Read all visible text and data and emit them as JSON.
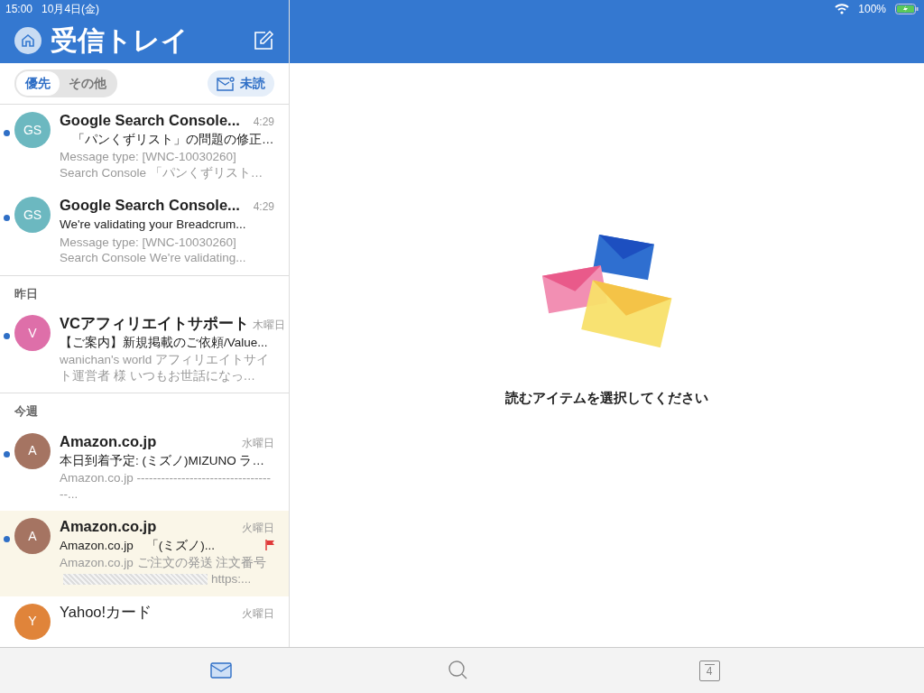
{
  "status_bar": {
    "time": "15:00",
    "date": "10月4日(金)",
    "battery": "100%"
  },
  "header": {
    "title": "受信トレイ"
  },
  "filters": [
    {
      "label": "優先",
      "selected": true
    },
    {
      "label": "その他",
      "selected": false
    }
  ],
  "unread_filter": {
    "label": "未読"
  },
  "sections": [
    {
      "messages": [
        {
          "initials": "GS",
          "color": "#6cb8c0",
          "sender": "Google Search Console...",
          "time": "4:29",
          "subject": "　「パンくずリスト」の問題の修正…",
          "preview": "Message type: [WNC-10030260] Search Console 「パンくずリスト…",
          "unread": true,
          "selected": false,
          "flagged": false
        },
        {
          "initials": "GS",
          "color": "#6cb8c0",
          "sender": "Google Search Console...",
          "time": "4:29",
          "subject": "We're validating your Breadcrum...",
          "preview": "Message type: [WNC-10030260] Search Console We're validating...",
          "unread": true,
          "selected": false,
          "flagged": false
        }
      ]
    },
    {
      "heading": "昨日",
      "messages": [
        {
          "initials": "V",
          "color": "#de6fa9",
          "sender": "VCアフィリエイトサポート",
          "time": "木曜日",
          "subject": "【ご案内】新規掲載のご依頼/Value...",
          "preview": "wanichan's world アフィリエイトサイト運営者 様 いつもお世話になっ…",
          "unread": true,
          "selected": false,
          "flagged": false
        }
      ]
    },
    {
      "heading": "今週",
      "messages": [
        {
          "initials": "A",
          "color": "#a57462",
          "sender": "Amazon.co.jp",
          "time": "水曜日",
          "subject": "本日到着予定: (ミズノ)MIZUNO ラ…",
          "preview": "Amazon.co.jp -----------------------------------...",
          "unread": true,
          "selected": false,
          "flagged": false
        },
        {
          "initials": "A",
          "color": "#a57462",
          "sender": "Amazon.co.jp",
          "time": "火曜日",
          "subject": "Amazon.co.jp　「(ミズノ)...",
          "preview": "Amazon.co.jp ご注文の発送 注文番号",
          "redacted": true,
          "preview_end": "https:...",
          "unread": true,
          "selected": true,
          "flagged": true
        },
        {
          "initials": "Y",
          "color": "#e0843a",
          "sender": "Yahoo!カード",
          "time": "火曜日",
          "unread": false,
          "selected": false,
          "flagged": false
        }
      ]
    }
  ],
  "empty_state": {
    "text": "読むアイテムを選択してください"
  },
  "tab_bar": [
    {
      "kind": "mail",
      "selected": true
    },
    {
      "kind": "search",
      "selected": false
    },
    {
      "kind": "calendar",
      "label": "4",
      "selected": false
    }
  ]
}
